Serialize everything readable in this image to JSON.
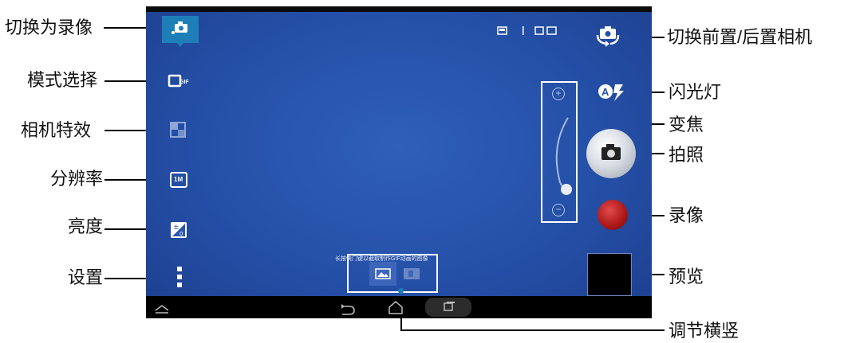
{
  "labels": {
    "switch_to_video": "切换为录像",
    "mode_select": "模式选择",
    "camera_effects": "相机特效",
    "resolution": "分辨率",
    "brightness": "亮度",
    "settings": "设置",
    "switch_front_rear": "切换前置/后置相机",
    "flash": "闪光灯",
    "zoom": "变焦",
    "take_photo": "拍照",
    "record_video": "录像",
    "preview": "预览",
    "orientation": "调节横竖"
  },
  "camera": {
    "hint_text": "长按快门键以截取制作GIF动画的图像",
    "resolution_badge": "1M",
    "mode_badge": "GIF",
    "zoom_plus": "+",
    "zoom_minus": "−",
    "zoom_level": 0.15
  },
  "colors": {
    "screen_bg": "#2550a8",
    "record": "#b01a1a",
    "active_tab": "#1e7fb8"
  },
  "icons": [
    "camera-switch-icon",
    "gif-mode-icon",
    "effects-icon",
    "resolution-icon",
    "brightness-icon",
    "more-icon",
    "front-rear-icon",
    "flash-auto-icon",
    "shutter-icon",
    "record-icon",
    "back-icon",
    "home-icon",
    "recent-apps-icon",
    "rotate-icon"
  ]
}
